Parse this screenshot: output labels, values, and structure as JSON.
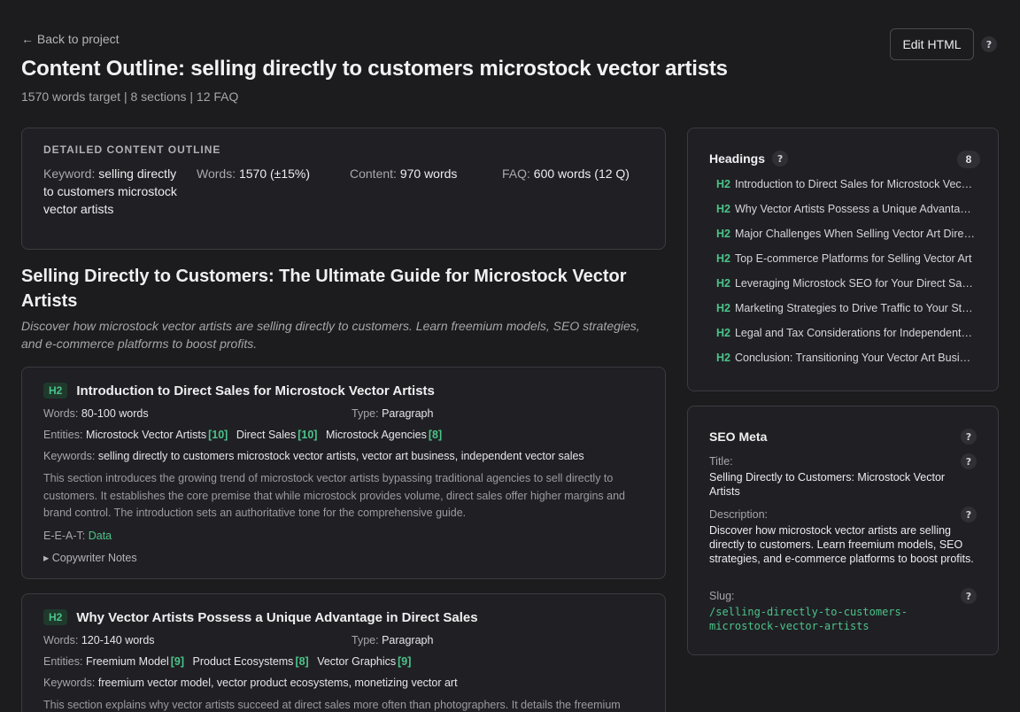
{
  "nav": {
    "back_label": "← Back to project"
  },
  "header": {
    "title": "Content Outline: selling directly to customers microstock vector artists",
    "subtitle": "1570 words target | 8 sections | 12 FAQ",
    "edit_label": "Edit HTML",
    "help": "?"
  },
  "overview": {
    "label": "DETAILED CONTENT OUTLINE",
    "keyword_label": "Keyword:",
    "keyword_value": "selling directly to customers microstock vector artists",
    "words_label": "Words:",
    "words_value": "1570 (±15%)",
    "content_label": "Content:",
    "content_value": "970 words",
    "faq_label": "FAQ:",
    "faq_value": "600 words (12 Q)"
  },
  "article": {
    "h1": "Selling Directly to Customers: The Ultimate Guide for Microstock Vector Artists",
    "description": "Discover how microstock vector artists are selling directly to customers. Learn freemium models, SEO strategies, and e-commerce platforms to boost profits."
  },
  "sections": [
    {
      "tag": "H2",
      "title": "Introduction to Direct Sales for Microstock Vector Artists",
      "words_label": "Words:",
      "words": "80-100 words",
      "type_label": "Type:",
      "type": "Paragraph",
      "entities_label": "Entities:",
      "entities": [
        {
          "name": "Microstock Vector Artists",
          "count": "[10]"
        },
        {
          "name": "Direct Sales",
          "count": "[10]"
        },
        {
          "name": "Microstock Agencies",
          "count": "[8]"
        }
      ],
      "keywords_label": "Keywords:",
      "keywords": "selling directly to customers microstock vector artists, vector art business, independent vector sales",
      "body": "This section introduces the growing trend of microstock vector artists bypassing traditional agencies to sell directly to customers. It establishes the core premise that while microstock provides volume, direct sales offer higher margins and brand control. The introduction sets an authoritative tone for the comprehensive guide.",
      "eeat_label": "E-E-A-T:",
      "eeat": "Data",
      "notes": "▸ Copywriter Notes"
    },
    {
      "tag": "H2",
      "title": "Why Vector Artists Possess a Unique Advantage in Direct Sales",
      "words_label": "Words:",
      "words": "120-140 words",
      "type_label": "Type:",
      "type": "Paragraph",
      "entities_label": "Entities:",
      "entities": [
        {
          "name": "Freemium Model",
          "count": "[9]"
        },
        {
          "name": "Product Ecosystems",
          "count": "[8]"
        },
        {
          "name": "Vector Graphics",
          "count": "[9]"
        }
      ],
      "keywords_label": "Keywords:",
      "keywords": "freemium vector model, vector product ecosystems, monetizing vector art",
      "body": "This section explains why vector artists succeed at direct sales more often than photographers. It details the freemium"
    }
  ],
  "headings_panel": {
    "title": "Headings",
    "count": "8",
    "items": [
      {
        "tag": "H2",
        "text": "Introduction to Direct Sales for Microstock Vector Artists"
      },
      {
        "tag": "H2",
        "text": "Why Vector Artists Possess a Unique Advantage in Direct Sales"
      },
      {
        "tag": "H2",
        "text": "Major Challenges When Selling Vector Art Directly"
      },
      {
        "tag": "H2",
        "text": "Top E-commerce Platforms for Selling Vector Art"
      },
      {
        "tag": "H2",
        "text": "Leveraging Microstock SEO for Your Direct Sales"
      },
      {
        "tag": "H2",
        "text": "Marketing Strategies to Drive Traffic to Your Store"
      },
      {
        "tag": "H2",
        "text": "Legal and Tax Considerations for Independent Sellers"
      },
      {
        "tag": "H2",
        "text": "Conclusion: Transitioning Your Vector Art Business"
      }
    ]
  },
  "seo_meta": {
    "title": "SEO Meta",
    "title_label": "Title:",
    "title_value": "Selling Directly to Customers: Microstock Vector Artists",
    "description_label": "Description:",
    "description_value": "Discover how microstock vector artists are selling directly to customers. Learn freemium models, SEO strategies, and e-commerce platforms to boost profits.",
    "slug_label": "Slug:",
    "slug_value": "/selling-directly-to-customers-microstock-vector-artists"
  }
}
